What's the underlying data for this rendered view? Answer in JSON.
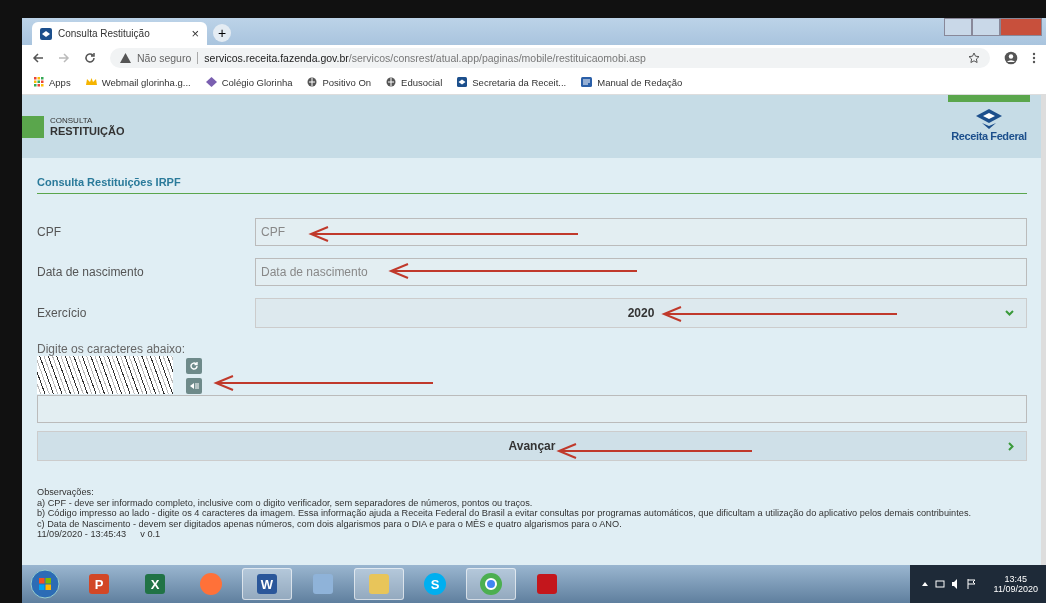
{
  "browser": {
    "tab": {
      "title": "Consulta Restituição",
      "close": "×"
    },
    "new_tab": "+",
    "address": {
      "security": "Não seguro",
      "host": "servicos.receita.fazenda.gov.br",
      "path": "/servicos/consrest/atual.app/paginas/mobile/restituicaomobi.asp"
    },
    "bookmarks": [
      {
        "kind": "apps",
        "label": "Apps"
      },
      {
        "kind": "crown",
        "label": "Webmail glorinha.g..."
      },
      {
        "kind": "diamond",
        "label": "Colégio Glorinha"
      },
      {
        "kind": "globe",
        "label": "Positivo On"
      },
      {
        "kind": "globe",
        "label": "Edusocial"
      },
      {
        "kind": "seal",
        "label": "Secretaria da Receit..."
      },
      {
        "kind": "book",
        "label": "Manual de Redação"
      }
    ]
  },
  "header": {
    "small": "CONSULTA",
    "title": "RESTITUIÇÃO",
    "logo_text": "Receita Federal"
  },
  "form": {
    "title": "Consulta Restituições IRPF",
    "fields": [
      {
        "kind": "text",
        "label": "CPF",
        "placeholder": "CPF"
      },
      {
        "kind": "text",
        "label": "Data de nascimento",
        "placeholder": "Data de nascimento"
      },
      {
        "kind": "select",
        "label": "Exercício",
        "value": "2020"
      }
    ],
    "captcha_label": "Digite os caracteres abaixo:",
    "submit": "Avançar"
  },
  "notes": {
    "title": "Observações:",
    "lines": [
      "a) CPF - deve ser informado completo, inclusive com o digito verificador, sem separadores de números, pontos ou traços.",
      "b) Código impresso ao lado - digite os 4 caracteres da imagem. Essa informação ajuda a Receita Federal do Brasil a evitar consultas por programas automáticos, que dificultam a utilização do aplicativo pelos demais contribuintes.",
      "c) Data de Nascimento - devem ser digitados apenas números, com dois algarismos para o DIA e para o MÊS e quatro algarismos para o ANO."
    ],
    "timestamp": "11/09/2020 - 13:45:43",
    "version": "v 0.1"
  },
  "taskbar": {
    "apps": [
      {
        "kind": "powerpoint",
        "letter": "P",
        "running": false
      },
      {
        "kind": "excel",
        "letter": "X",
        "running": false
      },
      {
        "kind": "firefox",
        "running": false
      },
      {
        "kind": "word",
        "letter": "W",
        "running": true
      },
      {
        "kind": "paint",
        "running": false
      },
      {
        "kind": "explorer",
        "running": true
      },
      {
        "kind": "skype",
        "letter": "S",
        "running": false
      },
      {
        "kind": "chrome",
        "running": true
      },
      {
        "kind": "pdf",
        "running": false
      }
    ],
    "time": "13:45",
    "date": "11/09/2020"
  }
}
